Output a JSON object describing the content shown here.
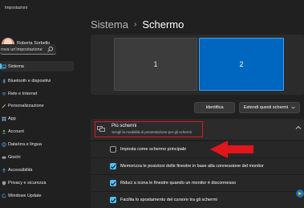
{
  "window": {
    "app_title": "Impostazioni"
  },
  "profile": {
    "name": "Roberta Sorbello"
  },
  "search": {
    "placeholder": "rova un'impostazione"
  },
  "sidebar": {
    "items": [
      {
        "label": "Sistema",
        "icon": "laptop-icon",
        "active": true
      },
      {
        "label": "Bluetooth e dispositivi",
        "icon": "bluetooth-icon",
        "active": false
      },
      {
        "label": "Rete e Internet",
        "icon": "wifi-icon",
        "active": false
      },
      {
        "label": "Personalizzazione",
        "icon": "brush-icon",
        "active": false
      },
      {
        "label": "App",
        "icon": "apps-icon",
        "active": false
      },
      {
        "label": "Account",
        "icon": "person-icon",
        "active": false
      },
      {
        "label": "Data/ora e lingua",
        "icon": "globe-icon",
        "active": false
      },
      {
        "label": "Giochi",
        "icon": "gamepad-icon",
        "active": false
      },
      {
        "label": "Accessibilità",
        "icon": "accessibility-icon",
        "active": false
      },
      {
        "label": "Privacy e sicurezza",
        "icon": "shield-icon",
        "active": false
      },
      {
        "label": "Windows Update",
        "icon": "update-icon",
        "active": false
      }
    ]
  },
  "breadcrumb": {
    "parent": "Sistema",
    "separator": "›",
    "current": "Schermo"
  },
  "monitors": {
    "display_1": "1",
    "display_2": "2",
    "selected": "2"
  },
  "toolbar": {
    "identify_label": "Identifica",
    "extend_label": "Estendi questi schermi"
  },
  "multiple_displays": {
    "title": "Più schermi",
    "description": "Scegli la modalità di presentazione per gli schermi",
    "expanded": true,
    "options": [
      {
        "label": "Imposta come schermo principale",
        "checked": false
      },
      {
        "label": "Memorizza le posizioni delle finestre in base alla connessione del monitor",
        "checked": true
      },
      {
        "label": "Riduci a icona le finestre quando un monitor è disconnesso",
        "checked": true
      },
      {
        "label": "Facilita lo spostamento del cursore tra gli schermi",
        "checked": true
      }
    ]
  },
  "colors": {
    "accent": "#4cc2ff",
    "selected_monitor": "#0067c0",
    "highlight": "#e0161b",
    "background": "#202020"
  }
}
